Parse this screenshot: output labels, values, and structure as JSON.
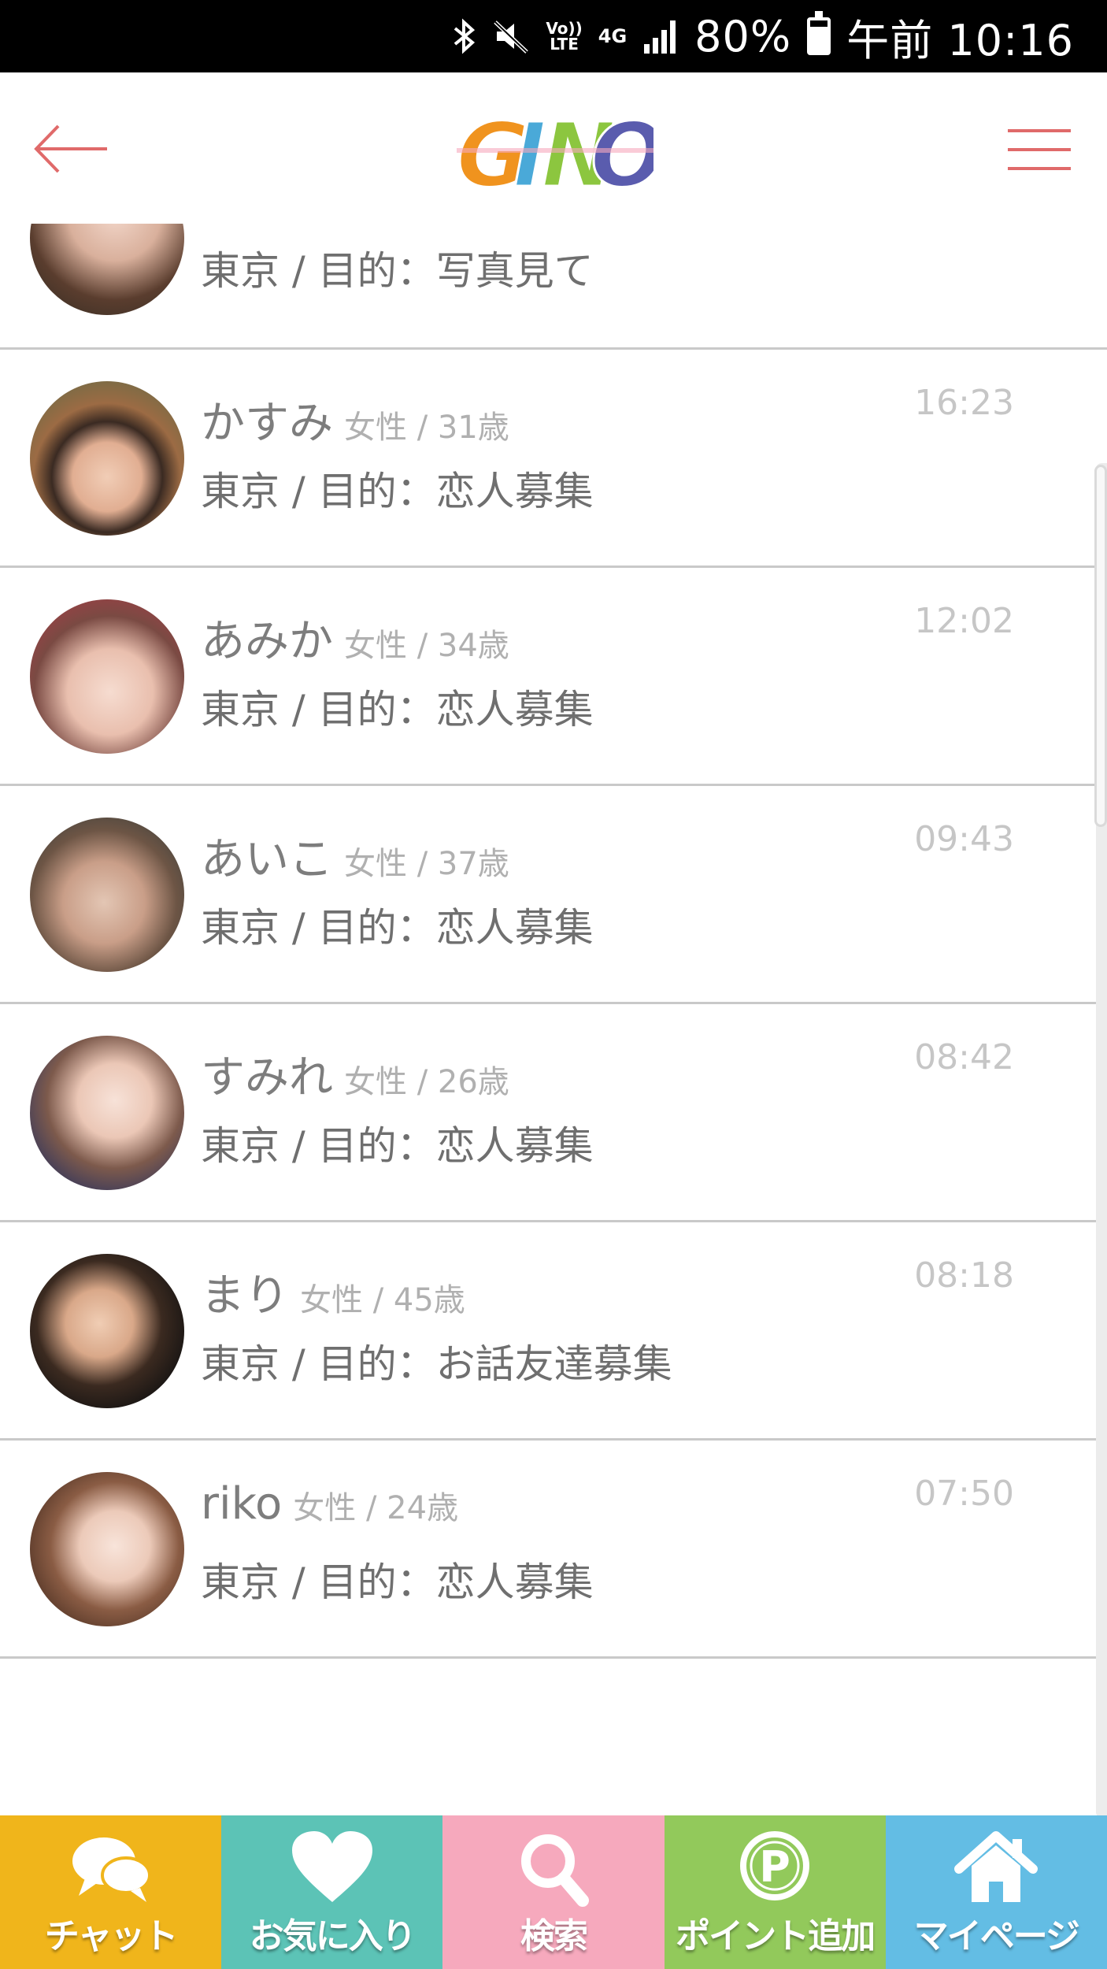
{
  "status_bar": {
    "volte_label": "Vo))\nLTE",
    "network_label": "4G",
    "battery_percent": "80%",
    "battery_level": 0.8,
    "time": "午前 10:16"
  },
  "header": {
    "logo_text": "GINO",
    "accent_color": "#e06a6a"
  },
  "messages": [
    {
      "sub": "東京 / 目的：写真見て"
    },
    {
      "name": "かすみ",
      "meta": "女性 / 31歳",
      "sub": "東京 / 目的：恋人募集",
      "time": "16:23"
    },
    {
      "name": "あみか",
      "meta": "女性 / 34歳",
      "sub": "東京 / 目的：恋人募集",
      "time": "12:02"
    },
    {
      "name": "あいこ",
      "meta": "女性 / 37歳",
      "sub": "東京 / 目的：恋人募集",
      "time": "09:43"
    },
    {
      "name": "すみれ",
      "meta": "女性 / 26歳",
      "sub": "東京 / 目的：恋人募集",
      "time": "08:42"
    },
    {
      "name": "まり",
      "meta": "女性 / 45歳",
      "sub": "東京 / 目的：お話友達募集",
      "time": "08:18"
    },
    {
      "name": "riko",
      "meta": "女性 / 24歳",
      "sub": "東京 / 目的：恋人募集",
      "time": "07:50"
    }
  ],
  "bottom_nav": [
    {
      "label": "チャット",
      "icon": "chat-bubbles-icon",
      "color": "#f0b51b"
    },
    {
      "label": "お気に入り",
      "icon": "heart-icon",
      "color": "#5cc3b6"
    },
    {
      "label": "検索",
      "icon": "magnifier-icon",
      "color": "#f6a9bd"
    },
    {
      "label": "ポイント追加",
      "icon": "point-p-icon",
      "color": "#92c95b"
    },
    {
      "label": "マイページ",
      "icon": "home-icon",
      "color": "#63bde4"
    }
  ]
}
